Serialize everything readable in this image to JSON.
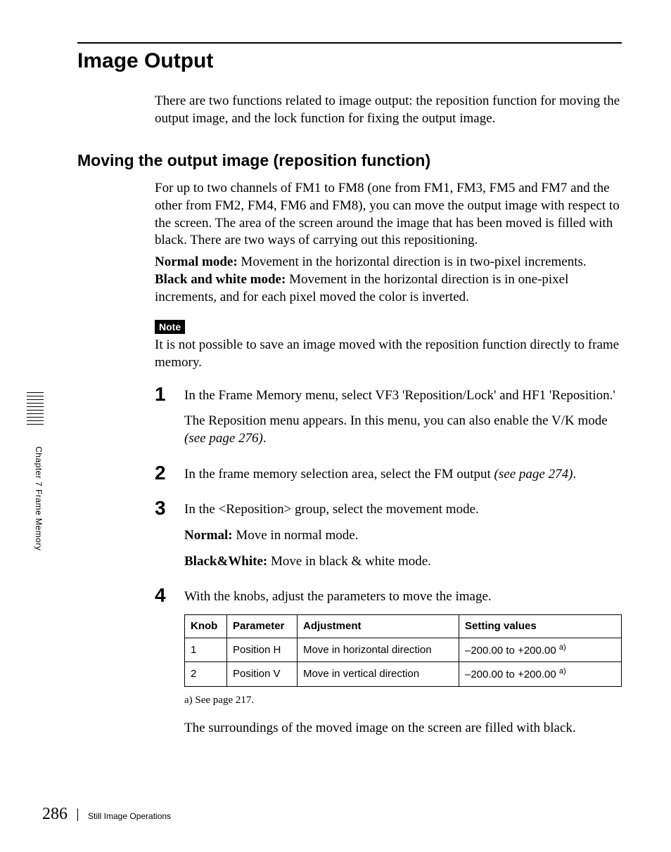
{
  "title": "Image Output",
  "intro": "There are two functions related to image output: the reposition function for moving the output image, and the lock function for fixing the output image.",
  "subhead": "Moving the output image (reposition function)",
  "para1": "For up to two channels of FM1 to FM8 (one from FM1, FM3, FM5 and FM7 and the other from FM2, FM4, FM6 and FM8), you can move the output image with respect to the screen. The area of the screen around the image that has been moved is filled with black. There are two ways of carrying out this repositioning.",
  "mode1_label": "Normal mode:",
  "mode1_text": " Movement in the horizontal direction is in two-pixel increments.",
  "mode2_label": "Black and white mode:",
  "mode2_text": " Movement in the horizontal direction is in one-pixel increments, and for each pixel moved the color is inverted.",
  "note_label": "Note",
  "note_body": "It is not possible to save an image moved with the reposition function directly to frame memory.",
  "steps": {
    "s1": {
      "num": "1",
      "line1": "In the Frame Memory menu, select VF3 'Reposition/Lock' and HF1 'Reposition.'",
      "line2a": "The Reposition menu appears. In this menu, you can also enable the V/K mode ",
      "line2b": "(see page 276)",
      "line2c": "."
    },
    "s2": {
      "num": "2",
      "text_a": "In the frame memory selection area, select the FM output ",
      "text_b": "(see page 274)",
      "text_c": "."
    },
    "s3": {
      "num": "3",
      "line1": "In the <Reposition> group, select the movement mode.",
      "opt1_label": "Normal:",
      "opt1_text": " Move in normal mode.",
      "opt2_label": "Black&White:",
      "opt2_text": " Move in black & white mode."
    },
    "s4": {
      "num": "4",
      "line1": "With the knobs, adjust the parameters to move the image."
    }
  },
  "table": {
    "headers": {
      "knob": "Knob",
      "param": "Parameter",
      "adj": "Adjustment",
      "vals": "Setting values"
    },
    "rows": [
      {
        "knob": "1",
        "param": "Position H",
        "adj": "Move in horizontal direction",
        "vals_pre": "–200.00 to +200.00 ",
        "vals_sup": "a)"
      },
      {
        "knob": "2",
        "param": "Position V",
        "adj": "Move in vertical direction",
        "vals_pre": "–200.00 to +200.00 ",
        "vals_sup": "a)"
      }
    ],
    "footnote": "a) See page 217."
  },
  "after_table": "The surroundings of the moved image on the screen are filled with black.",
  "sidebar": "Chapter 7  Frame Memory",
  "footer": {
    "page": "286",
    "text": "Still Image Operations"
  }
}
